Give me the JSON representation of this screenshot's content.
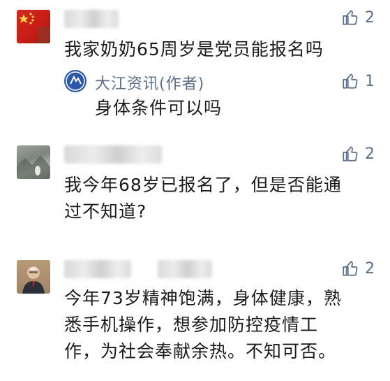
{
  "comments": [
    {
      "likes": "2",
      "text": "我家奶奶65周岁是党员能报名吗",
      "reply": {
        "author": "大江资讯(作者)",
        "likes": "1",
        "text": "身体条件可以吗"
      }
    },
    {
      "likes": "2",
      "text": "我今年68岁已报名了，但是否能通\n过不知道?"
    },
    {
      "likes": "2",
      "text": "今年73岁精神饱满，身体健康，熟\n悉手机操作，想参加防控疫情工\n作，为社会奉献余热。不知可否。"
    }
  ],
  "icons": {
    "like": "thumbs-up-icon"
  },
  "colors": {
    "link_gray_blue": "#5b6f8a",
    "text": "#1b1b1b",
    "author_badge": "#2c58a8"
  }
}
